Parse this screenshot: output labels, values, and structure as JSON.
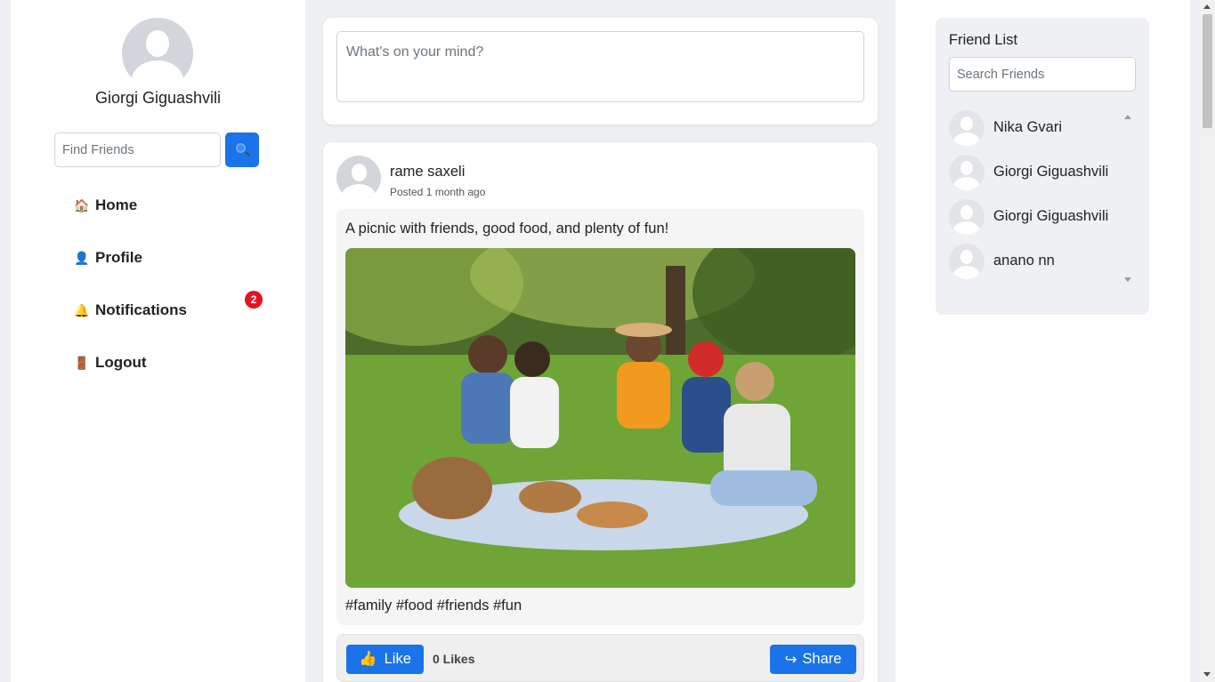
{
  "sidebar": {
    "user_name": "Giorgi Giguashvili",
    "find_placeholder": "Find Friends",
    "search_icon": "search-icon",
    "nav": [
      {
        "icon": "🏠",
        "label": "Home"
      },
      {
        "icon": "👤",
        "label": "Profile"
      },
      {
        "icon": "🔔",
        "label": "Notifications"
      },
      {
        "icon": "🚪",
        "label": "Logout"
      }
    ],
    "notifications_badge": "2"
  },
  "composer": {
    "placeholder": "What's on your mind?"
  },
  "post": {
    "author": "rame saxeli",
    "posted": "Posted 1 month ago",
    "caption": "A picnic with friends, good food, and plenty of fun!",
    "tags": "#family #food #friends #fun",
    "like_label": "Like",
    "like_icon": "👍",
    "likes_count": "0 Likes",
    "share_label": "Share",
    "share_icon": "↪"
  },
  "friend_list": {
    "title": "Friend List",
    "search_placeholder": "Search Friends",
    "friends": [
      "Nika Gvari",
      "Giorgi Giguashvili",
      "Giorgi Giguashvili",
      "anano nn"
    ]
  },
  "colors": {
    "accent": "#1a73e8",
    "badge": "#e3141d",
    "page_bg": "#eef0f3"
  }
}
